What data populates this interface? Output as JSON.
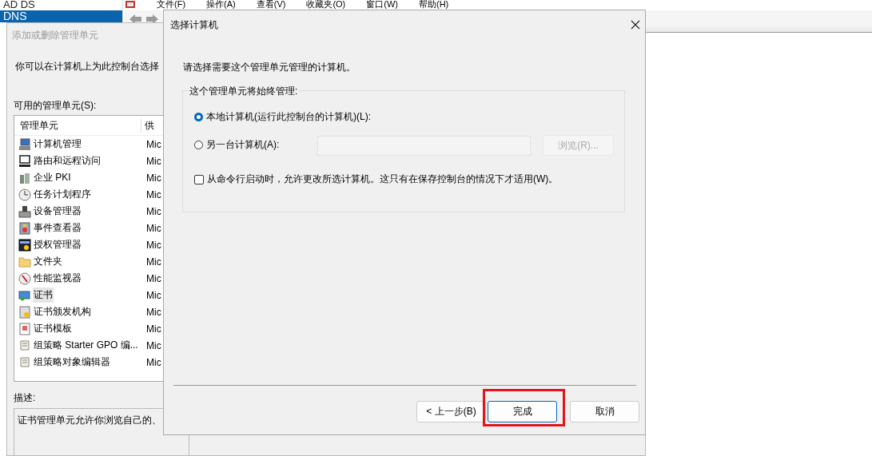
{
  "console": {
    "tree_items": [
      {
        "label": "AD DS",
        "selected": false
      },
      {
        "label": "DNS",
        "selected": true
      }
    ],
    "menu": [
      "文件(F)",
      "操作(A)",
      "查看(V)",
      "收藏夹(O)",
      "窗口(W)",
      "帮助(H)"
    ]
  },
  "add_remove_dialog": {
    "title": "添加或删除管理单元",
    "intro": "你可以在计算机上为此控制台选择",
    "available_label": "可用的管理单元(S):",
    "columns": [
      "管理单元",
      "供"
    ],
    "rows": [
      {
        "name": "计算机管理",
        "vendor": "Mic",
        "selected": false
      },
      {
        "name": "路由和远程访问",
        "vendor": "Mic",
        "selected": false
      },
      {
        "name": "企业 PKI",
        "vendor": "Mic",
        "selected": false
      },
      {
        "name": "任务计划程序",
        "vendor": "Mic",
        "selected": false
      },
      {
        "name": "设备管理器",
        "vendor": "Mic",
        "selected": false
      },
      {
        "name": "事件查看器",
        "vendor": "Mic",
        "selected": false
      },
      {
        "name": "授权管理器",
        "vendor": "Mic",
        "selected": false
      },
      {
        "name": "文件夹",
        "vendor": "Mic",
        "selected": false
      },
      {
        "name": "性能监视器",
        "vendor": "Mic",
        "selected": false
      },
      {
        "name": "证书",
        "vendor": "Mic",
        "selected": true
      },
      {
        "name": "证书颁发机构",
        "vendor": "Mic",
        "selected": false
      },
      {
        "name": "证书模板",
        "vendor": "Mic",
        "selected": false
      },
      {
        "name": "组策略 Starter GPO 编...",
        "vendor": "Mic",
        "selected": false
      },
      {
        "name": "组策略对象编辑器",
        "vendor": "Mic",
        "selected": false
      }
    ],
    "description_label": "描述:",
    "description": "证书管理单元允许你浏览自己的、"
  },
  "select_computer_dialog": {
    "title": "选择计算机",
    "intro": "请选择需要这个管理单元管理的计算机。",
    "group_label": "这个管理单元将始终管理:",
    "options": [
      {
        "label": "本地计算机(运行此控制台的计算机)(L):",
        "selected": true
      },
      {
        "label": "另一台计算机(A):",
        "selected": false
      }
    ],
    "computer_field": {
      "disabled": true
    },
    "browse_button": {
      "label": "浏览(R)...",
      "disabled": true
    },
    "allow_change": {
      "label": "从命令行启动时，允许更改所选计算机。这只有在保存控制台的情况下才适用(W)。",
      "checked": false
    },
    "buttons": [
      {
        "label": "< 上一步(B)",
        "kind": "normal",
        "highlighted": false
      },
      {
        "label": "完成",
        "kind": "default",
        "highlighted": true
      },
      {
        "label": "取消",
        "kind": "normal",
        "highlighted": false
      }
    ]
  }
}
